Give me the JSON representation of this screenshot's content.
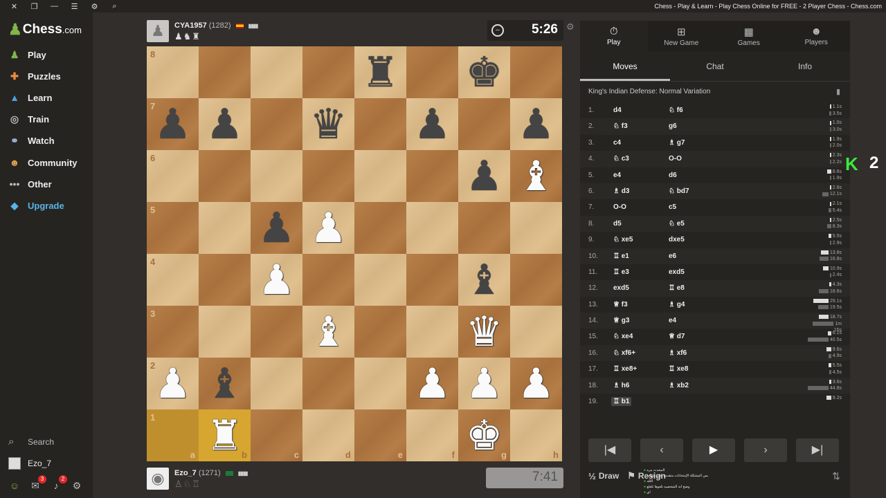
{
  "window": {
    "title": "Chess - Play & Learn - Play Chess Online for FREE - 2 Player Chess - Chess.com"
  },
  "sidebar": {
    "logo_text": "Chess",
    "logo_suffix": ".com",
    "items": [
      {
        "label": "Play",
        "icon": "play-pawn-icon"
      },
      {
        "label": "Puzzles",
        "icon": "puzzle-icon"
      },
      {
        "label": "Learn",
        "icon": "graduation-cap-icon"
      },
      {
        "label": "Train",
        "icon": "target-icon"
      },
      {
        "label": "Watch",
        "icon": "binoculars-icon"
      },
      {
        "label": "Community",
        "icon": "community-icon"
      },
      {
        "label": "Other",
        "icon": "ellipsis-icon"
      },
      {
        "label": "Upgrade",
        "icon": "diamond-icon"
      }
    ],
    "search_label": "Search",
    "username": "Ezo_7",
    "messages_badge": "3",
    "notifications_badge": "2"
  },
  "opponent": {
    "name": "CYA1957",
    "rating": "(1282)",
    "captures": "♟♞♜",
    "clock": "5:26"
  },
  "player": {
    "name": "Ezo_7",
    "rating": "(1271)",
    "captures": "♙♘♖",
    "clock": "7:41"
  },
  "board": {
    "files": [
      "a",
      "b",
      "c",
      "d",
      "e",
      "f",
      "g",
      "h"
    ],
    "ranks": [
      "8",
      "7",
      "6",
      "5",
      "4",
      "3",
      "2",
      "1"
    ],
    "highlight": [
      "a1",
      "b1"
    ],
    "pieces": [
      {
        "sq": "e8",
        "p": "r",
        "c": "b"
      },
      {
        "sq": "g8",
        "p": "k",
        "c": "b"
      },
      {
        "sq": "a7",
        "p": "p",
        "c": "b"
      },
      {
        "sq": "b7",
        "p": "p",
        "c": "b"
      },
      {
        "sq": "d7",
        "p": "q",
        "c": "b"
      },
      {
        "sq": "f7",
        "p": "p",
        "c": "b"
      },
      {
        "sq": "h7",
        "p": "p",
        "c": "b"
      },
      {
        "sq": "g6",
        "p": "p",
        "c": "b"
      },
      {
        "sq": "h6",
        "p": "b",
        "c": "w"
      },
      {
        "sq": "c5",
        "p": "p",
        "c": "b"
      },
      {
        "sq": "d5",
        "p": "p",
        "c": "w"
      },
      {
        "sq": "c4",
        "p": "p",
        "c": "w"
      },
      {
        "sq": "g4",
        "p": "b",
        "c": "b"
      },
      {
        "sq": "d3",
        "p": "b",
        "c": "w"
      },
      {
        "sq": "g3",
        "p": "q",
        "c": "w"
      },
      {
        "sq": "a2",
        "p": "p",
        "c": "w"
      },
      {
        "sq": "b2",
        "p": "b",
        "c": "b"
      },
      {
        "sq": "f2",
        "p": "p",
        "c": "w"
      },
      {
        "sq": "g2",
        "p": "p",
        "c": "w"
      },
      {
        "sq": "h2",
        "p": "p",
        "c": "w"
      },
      {
        "sq": "b1",
        "p": "r",
        "c": "w"
      },
      {
        "sq": "g1",
        "p": "k",
        "c": "w"
      }
    ]
  },
  "panel": {
    "tabs": [
      {
        "label": "Play",
        "icon": "stopwatch-icon"
      },
      {
        "label": "New Game",
        "icon": "plus-square-icon"
      },
      {
        "label": "Games",
        "icon": "board-icon"
      },
      {
        "label": "Players",
        "icon": "players-icon"
      }
    ],
    "subtabs": [
      "Moves",
      "Chat",
      "Info"
    ],
    "opening": "King's Indian Defense: Normal Variation",
    "moves": [
      {
        "n": "1.",
        "w": "d4",
        "b": "♘ f6",
        "wt": "1.1s",
        "bt": "3.5s",
        "wf": 0.03,
        "bf": 0.1
      },
      {
        "n": "2.",
        "w": "♘ f3",
        "b": "g6",
        "wt": "1.0s",
        "bt": "3.0s",
        "wf": 0.03,
        "bf": 0.08
      },
      {
        "n": "3.",
        "w": "c4",
        "b": "♗ g7",
        "wt": "1.9s",
        "bt": "2.0s",
        "wf": 0.05,
        "bf": 0.06
      },
      {
        "n": "4.",
        "w": "♘ c3",
        "b": "O-O",
        "wt": "2.3s",
        "bt": "2.2s",
        "wf": 0.06,
        "bf": 0.06
      },
      {
        "n": "5.",
        "w": "e4",
        "b": "d6",
        "wt": "8.6s",
        "bt": "1.9s",
        "wf": 0.2,
        "bf": 0.05
      },
      {
        "n": "6.",
        "w": "♗ d3",
        "b": "♘ bd7",
        "wt": "2.6s",
        "bt": "12.1s",
        "wf": 0.06,
        "bf": 0.3
      },
      {
        "n": "7.",
        "w": "O-O",
        "b": "c5",
        "wt": "2.1s",
        "bt": "5.4s",
        "wf": 0.05,
        "bf": 0.14
      },
      {
        "n": "8.",
        "w": "d5",
        "b": "♘ e5",
        "wt": "2.5s",
        "bt": "8.3s",
        "wf": 0.06,
        "bf": 0.2
      },
      {
        "n": "9.",
        "w": "♘ xe5",
        "b": "dxe5",
        "wt": "5.5s",
        "bt": "2.9s",
        "wf": 0.14,
        "bf": 0.07
      },
      {
        "n": "10.",
        "w": "♖ e1",
        "b": "e6",
        "wt": "13.8s",
        "bt": "16.8s",
        "wf": 0.35,
        "bf": 0.42
      },
      {
        "n": "11.",
        "w": "♖ e3",
        "b": "exd5",
        "wt": "10.9s",
        "bt": "2.4s",
        "wf": 0.28,
        "bf": 0.06
      },
      {
        "n": "12.",
        "w": "exd5",
        "b": "♖ e8",
        "wt": "4.3s",
        "bt": "18.6s",
        "wf": 0.11,
        "bf": 0.47
      },
      {
        "n": "13.",
        "w": "♕ f3",
        "b": "♗ g4",
        "wt": "29.1s",
        "bt": "19.5s",
        "wf": 0.73,
        "bf": 0.49
      },
      {
        "n": "14.",
        "w": "♕ g3",
        "b": "e4",
        "wt": "18.7s",
        "bt": "1m 15s",
        "wf": 0.47,
        "bf": 1.0
      },
      {
        "n": "15.",
        "w": "♘ xe4",
        "b": "♕ d7",
        "wt": "6.1s",
        "bt": "40.5s",
        "wf": 0.15,
        "bf": 1.0
      },
      {
        "n": "16.",
        "w": "♘ xf6+",
        "b": "♗ xf6",
        "wt": "9.6s",
        "bt": "4.9s",
        "wf": 0.24,
        "bf": 0.12
      },
      {
        "n": "17.",
        "w": "♖ xe8+",
        "b": "♖ xe8",
        "wt": "5.5s",
        "bt": "4.5s",
        "wf": 0.14,
        "bf": 0.11
      },
      {
        "n": "18.",
        "w": "♗ h6",
        "b": "♗ xb2",
        "wt": "3.6s",
        "bt": "44.8s",
        "wf": 0.09,
        "bf": 1.0
      },
      {
        "n": "19.",
        "w": "♖ b1",
        "b": "",
        "wt": "9.2s",
        "bt": "",
        "wf": 0.23,
        "bf": 0
      }
    ],
    "draw_label": "Draw",
    "resign_label": "Resign"
  },
  "overlay": {
    "chat_lines": [
      "المحدث مره",
      "بس المشكلة الإمتحانات متقدمة على النهايه",
      "اللله",
      "وضح انه الشخصيه تلعوها تلعلع",
      "اي"
    ],
    "k_logo": "K",
    "k_number": "2"
  },
  "colors": {
    "accent_green": "#81b64c",
    "upgrade_blue": "#5ab2e6",
    "light_square": "#e0c08f",
    "dark_square": "#b07645",
    "highlight": "#d7a631"
  }
}
